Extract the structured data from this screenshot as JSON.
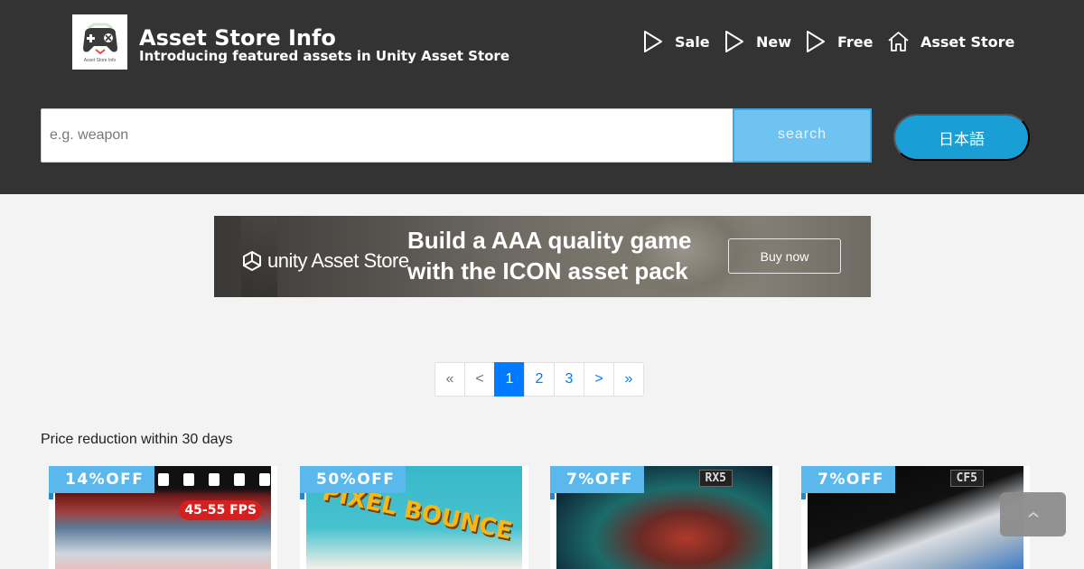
{
  "header": {
    "logo_caption": "Asset Store Info",
    "title": "Asset Store Info",
    "subtitle": "Introducing featured assets in Unity Asset Store",
    "nav": [
      {
        "label": "Sale",
        "icon": "play-icon"
      },
      {
        "label": "New",
        "icon": "play-icon"
      },
      {
        "label": "Free",
        "icon": "play-icon"
      },
      {
        "label": "Asset Store",
        "icon": "home-icon"
      }
    ]
  },
  "search": {
    "placeholder": "e.g. weapon",
    "value": "",
    "button_label": "search",
    "language_label": "日本語"
  },
  "banner": {
    "brand": "unity Asset Store",
    "headline_line1": "Build a AAA quality game",
    "headline_line2": "with the ICON asset pack",
    "cta": "Buy now"
  },
  "pagination": {
    "items": [
      "«",
      "<",
      "1",
      "2",
      "3",
      ">",
      "»"
    ],
    "current": "1"
  },
  "section": {
    "title": "Price reduction within 30 days"
  },
  "cards": [
    {
      "badge": "14%OFF",
      "thumb_text": "45-55 FPS"
    },
    {
      "badge": "50%OFF",
      "thumb_text": "PIXEL BOUNCE"
    },
    {
      "badge": "7%OFF",
      "thumb_text": "RX5"
    },
    {
      "badge": "7%OFF",
      "thumb_text": "CF5"
    }
  ],
  "colors": {
    "header_bg": "#333333",
    "accent": "#1a9ed6",
    "search_button": "#6fc3f0",
    "badge": "#5bb8ec",
    "page_active": "#007bff"
  }
}
